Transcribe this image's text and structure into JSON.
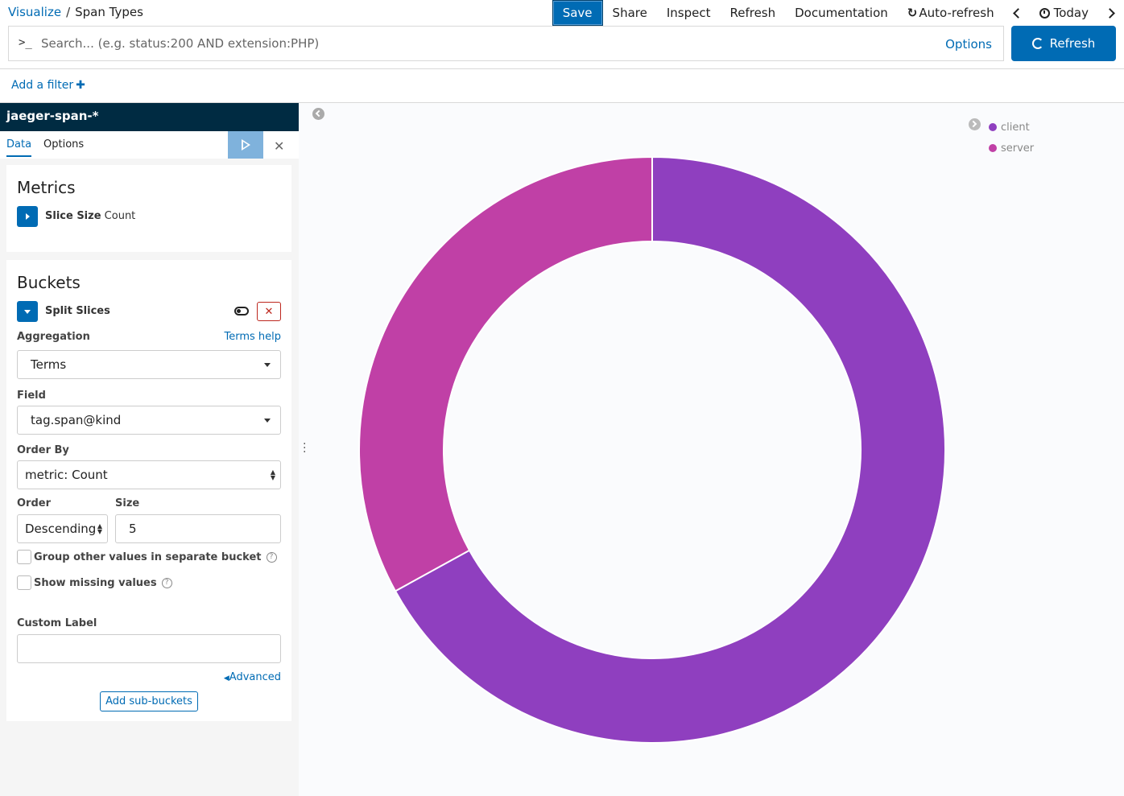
{
  "breadcrumb": {
    "root": "Visualize",
    "separator": "/",
    "current": "Span Types"
  },
  "nav": {
    "save": "Save",
    "share": "Share",
    "inspect": "Inspect",
    "refresh": "Refresh",
    "documentation": "Documentation",
    "auto_refresh": "Auto-refresh",
    "time": "Today"
  },
  "query": {
    "prompt": ">_",
    "placeholder": "Search... (e.g. status:200 AND extension:PHP)",
    "options": "Options",
    "refresh_button": "Refresh"
  },
  "filters": {
    "add_filter": "Add a filter"
  },
  "sidebar": {
    "index_pattern": "jaeger-span-*",
    "tabs": [
      "Data",
      "Options"
    ],
    "metrics": {
      "title": "Metrics",
      "agg_name": "Slice Size",
      "agg_type": "Count"
    },
    "buckets": {
      "title": "Buckets",
      "agg_name": "Split Slices",
      "aggregation_label": "Aggregation",
      "aggregation_help": "Terms help",
      "aggregation_value": "Terms",
      "field_label": "Field",
      "field_value": "tag.span@kind",
      "order_by_label": "Order By",
      "order_by_value": "metric: Count",
      "order_label": "Order",
      "order_value": "Descending",
      "size_label": "Size",
      "size_value": "5",
      "group_other": "Group other values in separate bucket",
      "show_missing": "Show missing values",
      "custom_label": "Custom Label",
      "custom_label_value": "",
      "advanced": "Advanced",
      "add_sub_buckets": "Add sub-buckets"
    }
  },
  "colors": {
    "client": "#8f3fbf",
    "server": "#c040a6",
    "accent": "#006bb4"
  },
  "chart_data": {
    "type": "pie",
    "donut": true,
    "series": [
      {
        "name": "client",
        "value": 0.67
      },
      {
        "name": "server",
        "value": 0.33
      }
    ],
    "legend_position": "top-right"
  }
}
